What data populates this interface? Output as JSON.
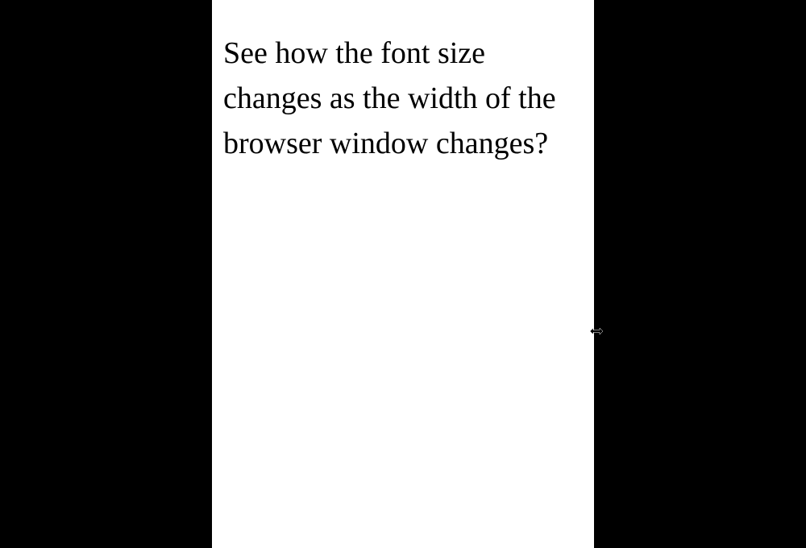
{
  "page": {
    "text": "See how the font size changes as the width of the browser window changes?"
  }
}
